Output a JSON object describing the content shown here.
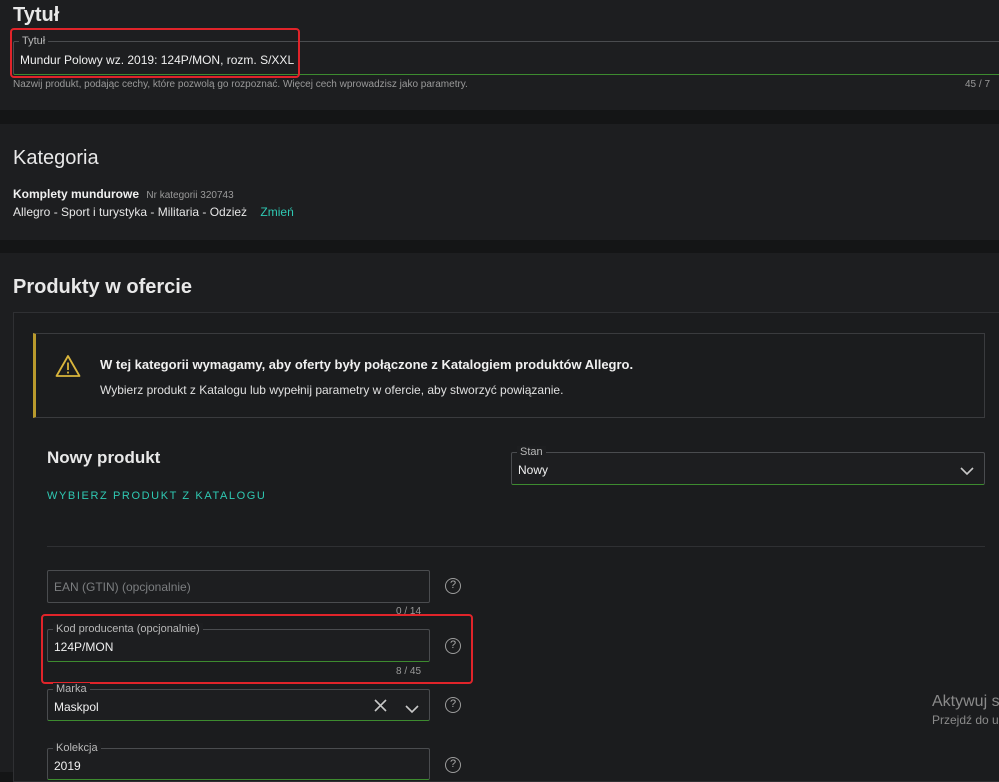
{
  "title_section": {
    "heading": "Tytuł",
    "field_label": "Tytuł",
    "field_value": "Mundur Polowy wz. 2019: 124P/MON, rozm. S/XXL",
    "hint": "Nazwij produkt, podając cechy, które pozwolą go rozpoznać. Więcej cech wprowadzisz jako parametry.",
    "counter": "45  /  7"
  },
  "category_section": {
    "heading": "Kategoria",
    "category_name": "Komplety mundurowe",
    "category_number": "Nr kategorii 320743",
    "path": "Allegro - Sport i turystyka - Militaria - Odzież",
    "change_link": "Zmień"
  },
  "products_section": {
    "heading": "Produkty w ofercie",
    "alert_title": "W tej kategorii wymagamy, aby oferty były połączone z Katalogiem produktów Allegro.",
    "alert_text": "Wybierz produkt z Katalogu lub wypełnij parametry w ofercie, aby stworzyć powiązanie.",
    "new_product_heading": "Nowy produkt",
    "choose_from_catalog": "WYBIERZ PRODUKT Z KATALOGU",
    "condition": {
      "label": "Stan",
      "value": "Nowy"
    },
    "ean": {
      "placeholder": "EAN (GTIN) (opcjonalnie)",
      "counter": "0  /  14"
    },
    "producer_code": {
      "label": "Kod producenta (opcjonalnie)",
      "value": "124P/MON",
      "counter": "8  /  45"
    },
    "brand": {
      "label": "Marka",
      "value": "Maskpol"
    },
    "collection": {
      "label": "Kolekcja",
      "value": "2019"
    }
  },
  "watermark": {
    "line1": "Aktywuj s",
    "line2": "Przejdź do u"
  },
  "colors": {
    "accent": "#2fc9b3",
    "highlight": "#e0242a",
    "warning": "#b99a2d",
    "field_underline": "#3d8b2f"
  }
}
